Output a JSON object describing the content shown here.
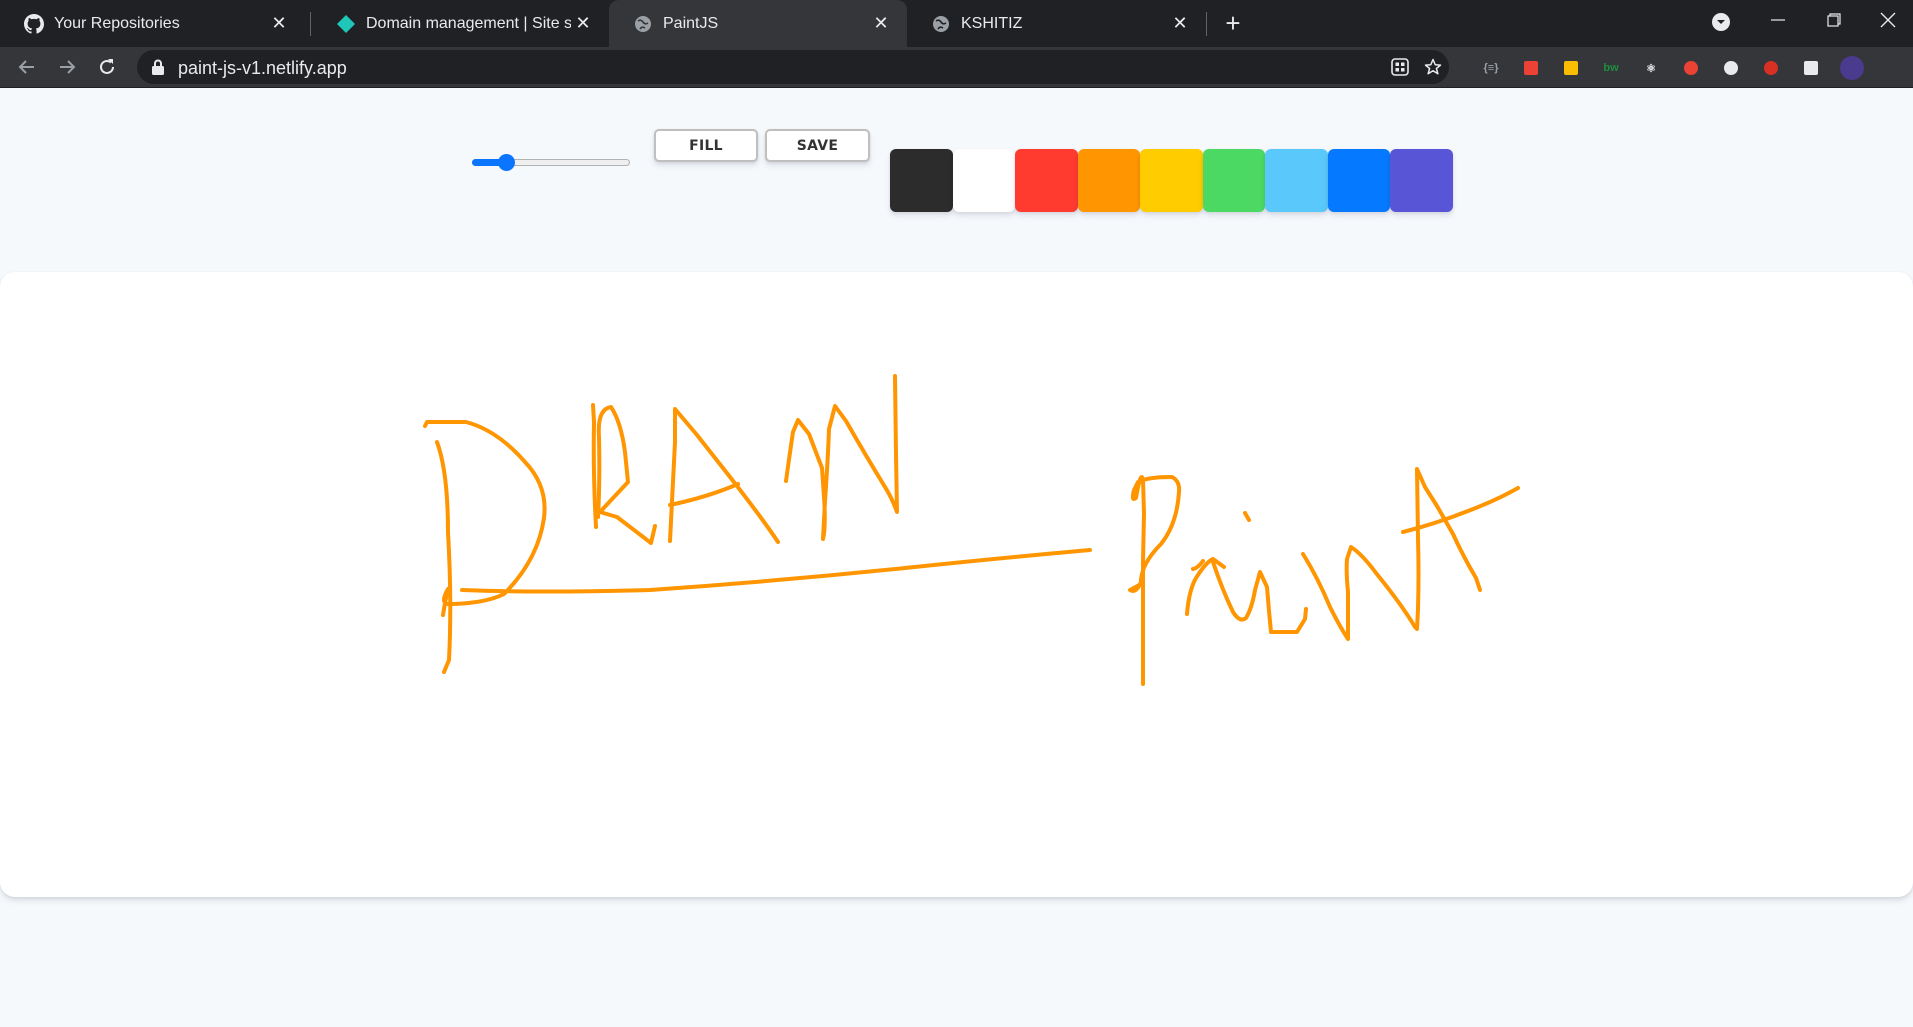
{
  "browser": {
    "tabs": [
      {
        "title": "Your Repositories",
        "icon": "github-icon",
        "active": false
      },
      {
        "title": "Domain management | Site settin",
        "icon": "netlify-icon",
        "active": false
      },
      {
        "title": "PaintJS",
        "icon": "globe-icon",
        "active": true
      },
      {
        "title": "KSHITIZ",
        "icon": "globe-icon",
        "active": false
      }
    ],
    "url": "paint-js-v1.netlify.app",
    "extensions": [
      {
        "name": "json-viewer-icon",
        "text": "{≡}",
        "color": "#9aa0a6"
      },
      {
        "name": "calendar-ext-icon",
        "text": "",
        "color": "#ea4335"
      },
      {
        "name": "hammer-ext-icon",
        "text": "",
        "color": "#fbbc04"
      },
      {
        "name": "bw-ext-icon",
        "text": "bw",
        "color": "#1e8e3e"
      },
      {
        "name": "react-devtools-icon",
        "text": "⚛",
        "color": "#e8eaed"
      },
      {
        "name": "colorful-ext-icon",
        "text": "",
        "color": "#ea4335"
      },
      {
        "name": "lighthouse-ext-icon",
        "text": "",
        "color": "#e8eaed"
      },
      {
        "name": "stop-ext-icon",
        "text": "",
        "color": "#d93025"
      },
      {
        "name": "puzzle-extensions-icon",
        "text": "",
        "color": "#e8eaed"
      },
      {
        "name": "profile-avatar-icon",
        "text": "",
        "color": "#4a3b8f"
      }
    ]
  },
  "controls": {
    "brush_size": 1.0,
    "brush_min": 0.1,
    "brush_max": 5.0,
    "fill_label": "Fill",
    "save_label": "Save"
  },
  "palette": [
    {
      "name": "black",
      "color": "#2c2c2c"
    },
    {
      "name": "white",
      "color": "#ffffff"
    },
    {
      "name": "red",
      "color": "#ff3b30"
    },
    {
      "name": "orange",
      "color": "#ff9500"
    },
    {
      "name": "yellow",
      "color": "#ffcc00"
    },
    {
      "name": "green",
      "color": "#4cd963"
    },
    {
      "name": "skyblue",
      "color": "#5ac8fa"
    },
    {
      "name": "blue",
      "color": "#0579ff"
    },
    {
      "name": "purple",
      "color": "#5856d6"
    }
  ],
  "canvas": {
    "stroke_color": "#ff9500"
  }
}
